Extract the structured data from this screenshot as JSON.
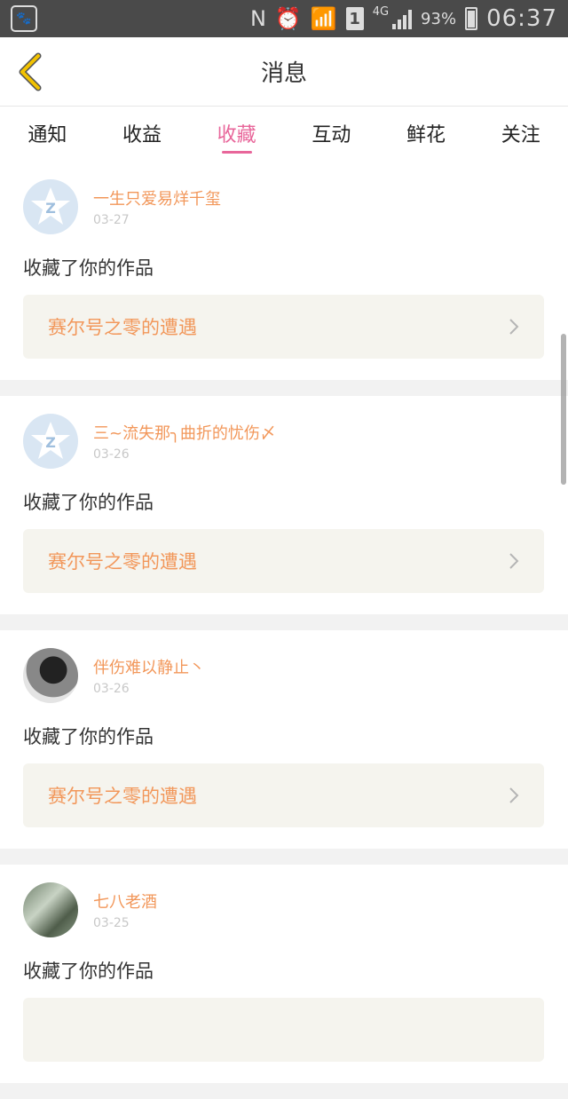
{
  "status_bar": {
    "app_icon": "paw-icon",
    "battery_pct": "93%",
    "network": "4G",
    "sim": "1",
    "time": "06:37"
  },
  "header": {
    "title": "消息"
  },
  "tabs": [
    {
      "label": "通知"
    },
    {
      "label": "收益"
    },
    {
      "label": "收藏",
      "active": true
    },
    {
      "label": "互动"
    },
    {
      "label": "鲜花"
    },
    {
      "label": "关注"
    }
  ],
  "notifications": [
    {
      "user": "一生只爱易烊千玺",
      "date": "03-27",
      "action": "收藏了你的作品",
      "work": "赛尔号之零的遭遇",
      "avatar": "default"
    },
    {
      "user": "三~流失那╮曲折的忧伤〆",
      "date": "03-26",
      "action": "收藏了你的作品",
      "work": "赛尔号之零的遭遇",
      "avatar": "default"
    },
    {
      "user": "伴伤难以静止丶",
      "date": "03-26",
      "action": "收藏了你的作品",
      "work": "赛尔号之零的遭遇",
      "avatar": "photo1"
    },
    {
      "user": "七八老酒",
      "date": "03-25",
      "action": "收藏了你的作品",
      "work": "",
      "avatar": "photo2"
    }
  ],
  "colors": {
    "accent": "#e8669a",
    "username": "#f2975a",
    "back_arrow": "#f2c200"
  }
}
